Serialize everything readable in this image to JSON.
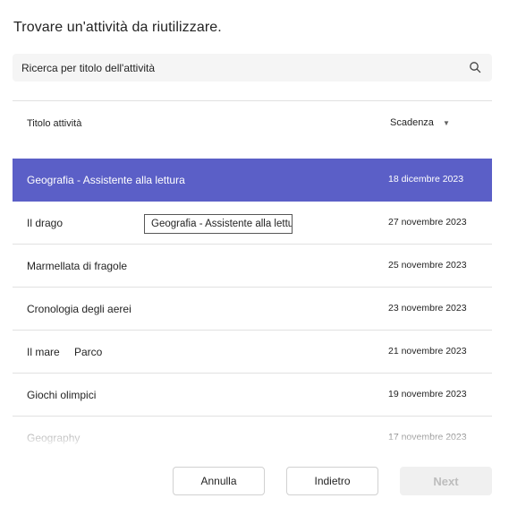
{
  "dialog": {
    "title": "Trovare un'attività da riutilizzare."
  },
  "search": {
    "placeholder": "Ricerca per titolo dell'attività",
    "icon": "search-icon"
  },
  "table": {
    "columns": {
      "title": "Titolo attività",
      "due": "Scadenza",
      "sort_icon": "caret-down-icon"
    },
    "rows": [
      {
        "title": "Geografia - Assistente alla lettura",
        "due": "18 dicembre 2023",
        "selected": true
      },
      {
        "title": "Il drago",
        "due": "27 novembre 2023"
      },
      {
        "title": "Marmellata di fragole",
        "due": "25 novembre 2023"
      },
      {
        "title": "Cronologia degli aerei",
        "due": "23 novembre 2023"
      },
      {
        "title": "Il mare",
        "extra": "Parco",
        "due": "21 novembre 2023"
      },
      {
        "title": "Giochi olimpici",
        "due": "19 novembre 2023"
      },
      {
        "title": "Geography",
        "due": "17 novembre 2023"
      }
    ]
  },
  "tooltip": {
    "text": "Geografia - Assistente alla lettura"
  },
  "buttons": {
    "cancel": "Annulla",
    "back": "Indietro",
    "next": "Next"
  },
  "colors": {
    "selected_row": "#5b5fc7",
    "search_bg": "#f5f5f5",
    "disabled_button": "#f0f0f0"
  }
}
